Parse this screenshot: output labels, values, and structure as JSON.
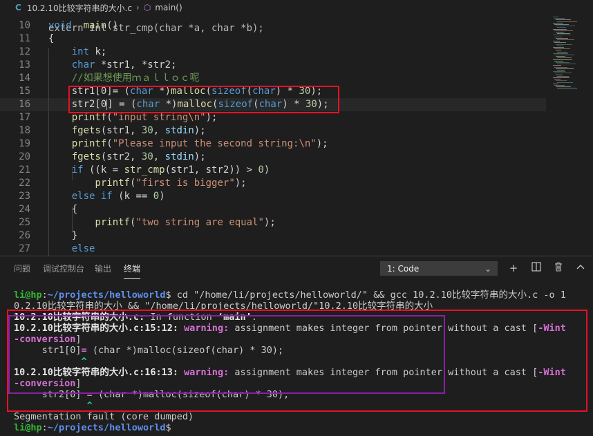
{
  "breadcrumb": {
    "file_icon": "C",
    "file": "10.2.10比较字符串的大小.c",
    "separator": "›",
    "symbol_icon": "cube-icon",
    "symbol": "main()"
  },
  "editor": {
    "scrolled_partial_text": "extern int str_cmp(char *a, char *b);",
    "lines": [
      {
        "n": "10",
        "tokens": [
          [
            "kw",
            "void"
          ],
          [
            "",
            "  "
          ],
          [
            "fn",
            "main"
          ],
          [
            "",
            "()"
          ]
        ]
      },
      {
        "n": "11",
        "tokens": [
          [
            "",
            "{"
          ]
        ]
      },
      {
        "n": "12",
        "tokens": [
          [
            "",
            "    "
          ],
          [
            "kw",
            "int"
          ],
          [
            "",
            " k;"
          ]
        ]
      },
      {
        "n": "13",
        "tokens": [
          [
            "",
            "    "
          ],
          [
            "kw",
            "char"
          ],
          [
            "",
            " *str1, *str2;"
          ]
        ]
      },
      {
        "n": "14",
        "tokens": [
          [
            "",
            "    "
          ],
          [
            "cmt",
            "//如果想使用ｍａｌｌｏｃ呢"
          ]
        ]
      },
      {
        "n": "15",
        "tokens": [
          [
            "",
            "    str1[0]= ("
          ],
          [
            "kw",
            "char"
          ],
          [
            "",
            " *)"
          ],
          [
            "fn",
            "malloc"
          ],
          [
            "",
            "("
          ],
          [
            "kw",
            "sizeof"
          ],
          [
            "",
            "("
          ],
          [
            "kw",
            "char"
          ],
          [
            "",
            ") * "
          ],
          [
            "num",
            "30"
          ],
          [
            "",
            ");"
          ]
        ]
      },
      {
        "n": "16",
        "tokens": [
          [
            "",
            "    str2[0"
          ],
          [
            "cursor",
            ""
          ],
          [
            "",
            "] = ("
          ],
          [
            "kw",
            "char"
          ],
          [
            "",
            " *)"
          ],
          [
            "fn",
            "malloc"
          ],
          [
            "",
            "("
          ],
          [
            "kw",
            "sizeof"
          ],
          [
            "",
            "("
          ],
          [
            "kw",
            "char"
          ],
          [
            "",
            ") * "
          ],
          [
            "num",
            "30"
          ],
          [
            "",
            ");"
          ]
        ]
      },
      {
        "n": "17",
        "tokens": [
          [
            "",
            "    "
          ],
          [
            "fn",
            "printf"
          ],
          [
            "",
            "("
          ],
          [
            "str",
            "\"input string\\n\""
          ],
          [
            "",
            ");"
          ]
        ]
      },
      {
        "n": "18",
        "tokens": [
          [
            "",
            "    "
          ],
          [
            "fn",
            "fgets"
          ],
          [
            "",
            "(str1, "
          ],
          [
            "num",
            "30"
          ],
          [
            "",
            ", "
          ],
          [
            "var",
            "stdin"
          ],
          [
            "",
            ");"
          ]
        ]
      },
      {
        "n": "19",
        "tokens": [
          [
            "",
            "    "
          ],
          [
            "fn",
            "printf"
          ],
          [
            "",
            "("
          ],
          [
            "str",
            "\"Please input the second string:\\n\""
          ],
          [
            "",
            ");"
          ]
        ]
      },
      {
        "n": "20",
        "tokens": [
          [
            "",
            "    "
          ],
          [
            "fn",
            "fgets"
          ],
          [
            "",
            "(str2, "
          ],
          [
            "num",
            "30"
          ],
          [
            "",
            ", "
          ],
          [
            "var",
            "stdin"
          ],
          [
            "",
            ");"
          ]
        ]
      },
      {
        "n": "21",
        "tokens": [
          [
            "",
            "    "
          ],
          [
            "kw",
            "if"
          ],
          [
            "",
            " ((k = "
          ],
          [
            "fn",
            "str_cmp"
          ],
          [
            "",
            "(str1, str2)) > "
          ],
          [
            "num",
            "0"
          ],
          [
            "",
            ")"
          ]
        ]
      },
      {
        "n": "22",
        "tokens": [
          [
            "",
            "        "
          ],
          [
            "fn",
            "printf"
          ],
          [
            "",
            "("
          ],
          [
            "str",
            "\"first is bigger\""
          ],
          [
            "",
            ");"
          ]
        ]
      },
      {
        "n": "23",
        "tokens": [
          [
            "",
            "    "
          ],
          [
            "kw",
            "else"
          ],
          [
            "",
            " "
          ],
          [
            "kw",
            "if"
          ],
          [
            "",
            " (k == "
          ],
          [
            "num",
            "0"
          ],
          [
            "",
            ")"
          ]
        ]
      },
      {
        "n": "24",
        "tokens": [
          [
            "",
            "    {"
          ]
        ]
      },
      {
        "n": "25",
        "tokens": [
          [
            "",
            "        "
          ],
          [
            "fn",
            "printf"
          ],
          [
            "",
            "("
          ],
          [
            "str",
            "\"two string are equal\""
          ],
          [
            "",
            ");"
          ]
        ]
      },
      {
        "n": "26",
        "tokens": [
          [
            "",
            "    }"
          ]
        ]
      },
      {
        "n": "27",
        "tokens": [
          [
            "",
            "    "
          ],
          [
            "kw",
            "else"
          ]
        ]
      }
    ]
  },
  "panel": {
    "tabs": [
      {
        "label": "问题",
        "active": false
      },
      {
        "label": "调试控制台",
        "active": false
      },
      {
        "label": "输出",
        "active": false
      },
      {
        "label": "终端",
        "active": true
      }
    ],
    "terminal_select": "1: Code",
    "icons": [
      "plus-icon",
      "split-terminal-icon",
      "trash-icon",
      "chevron-up-icon"
    ]
  },
  "terminal": {
    "lines": [
      [
        [
          "pg",
          "li@hp"
        ],
        [
          "",
          ":"
        ],
        [
          "pb",
          "~/projects/helloworld"
        ],
        [
          "",
          "$ cd \"/home/li/projects/helloworld/\" && gcc 10.2.10比较字符串的大小.c -o 1"
        ]
      ],
      [
        [
          "",
          "0.2.10比较字符串的大小 && \"/home/li/projects/helloworld/\"10.2.10比较字符串的大小"
        ]
      ],
      [
        [
          "wb",
          "10.2.10比较字符串的大小.c:"
        ],
        [
          "",
          " In function "
        ],
        [
          "wb",
          "‘main’"
        ],
        [
          "",
          ":"
        ]
      ],
      [
        [
          "wb",
          "10.2.10比较字符串的大小.c:15:12: "
        ],
        [
          "wm",
          "warning: "
        ],
        [
          "",
          "assignment makes integer from pointer without a cast ["
        ],
        [
          "wm",
          "-Wint"
        ]
      ],
      [
        [
          "wm",
          "-conversion"
        ],
        [
          "",
          "]"
        ]
      ],
      [
        [
          "",
          "     str1[0]"
        ],
        [
          "wm",
          "="
        ],
        [
          "",
          " (char *)malloc(sizeof(char) * 30);"
        ]
      ],
      [
        [
          "",
          "            "
        ],
        [
          "gr",
          "^"
        ]
      ],
      [
        [
          "wb",
          "10.2.10比较字符串的大小.c:16:13: "
        ],
        [
          "wm",
          "warning: "
        ],
        [
          "",
          "assignment makes integer from pointer without a cast ["
        ],
        [
          "wm",
          "-Wint"
        ]
      ],
      [
        [
          "wm",
          "-conversion"
        ],
        [
          "",
          "]"
        ]
      ],
      [
        [
          "",
          "     str2[0] "
        ],
        [
          "wm",
          "="
        ],
        [
          "",
          " (char *)malloc(sizeof(char) * 30);"
        ]
      ],
      [
        [
          "",
          "             "
        ],
        [
          "gr",
          "^"
        ]
      ],
      [
        [
          "",
          "Segmentation fault (core dumped)"
        ]
      ],
      [
        [
          "pg",
          "li@hp"
        ],
        [
          "",
          ":"
        ],
        [
          "pb",
          "~/projects/helloworld"
        ],
        [
          "",
          "$"
        ]
      ]
    ]
  },
  "colors": {
    "editor_bg": "#1e1e1e",
    "annotation_red": "#e81123",
    "annotation_purple": "#8b1fa9"
  }
}
